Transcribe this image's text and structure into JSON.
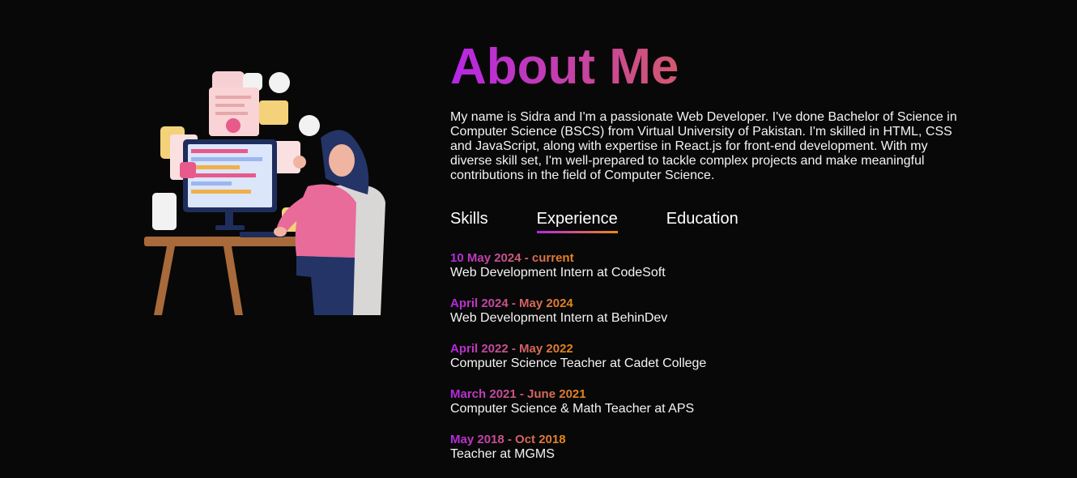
{
  "about": {
    "title": "About Me",
    "description": "My name is Sidra and I'm a passionate Web Developer. I've done Bachelor of Science in Computer Science (BSCS) from Virtual University of Pakistan. I'm skilled in HTML, CSS and JavaScript, along with expertise in React.js for front-end development. With my diverse skill set, I'm well-prepared to tackle complex projects and make meaningful contributions in the field of Computer Science."
  },
  "tabs": [
    {
      "label": "Skills",
      "active": false
    },
    {
      "label": "Experience",
      "active": true
    },
    {
      "label": "Education",
      "active": false
    }
  ],
  "experience": [
    {
      "date": "10 May 2024 - current",
      "role": "Web Development Intern at CodeSoft"
    },
    {
      "date": "April 2024 - May 2024",
      "role": "Web Development Intern at BehinDev"
    },
    {
      "date": "April 2022 - May 2022",
      "role": "Computer Science Teacher at Cadet College"
    },
    {
      "date": "March 2021 - June 2021",
      "role": "Computer Science & Math Teacher at APS"
    },
    {
      "date": "May 2018 - Oct 2018",
      "role": "Teacher at MGMS"
    }
  ],
  "colors": {
    "background": "#080808",
    "gradient_start": "#b626e6",
    "gradient_end": "#e88a14"
  }
}
